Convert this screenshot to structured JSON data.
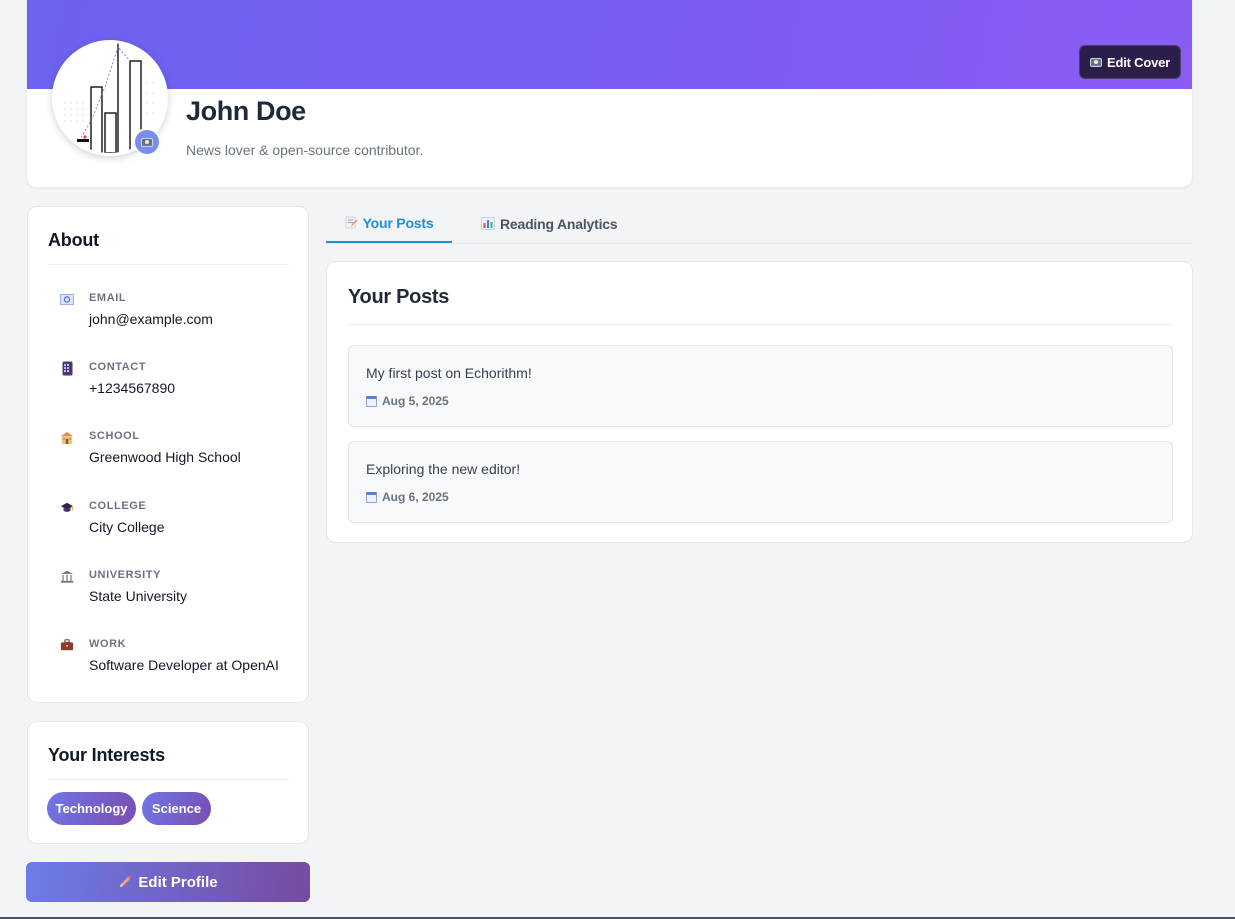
{
  "profile": {
    "name": "John Doe",
    "bio": "News lover & open-source contributor.",
    "edit_cover_label": "Edit Cover",
    "accent_gradient": [
      "#6c63f0",
      "#8b5cf6"
    ]
  },
  "about": {
    "title": "About",
    "items": [
      {
        "icon": "email-icon",
        "label": "EMAIL",
        "value": "john@example.com"
      },
      {
        "icon": "phone-icon",
        "label": "CONTACT",
        "value": "+1234567890"
      },
      {
        "icon": "school-icon",
        "label": "SCHOOL",
        "value": "Greenwood High School"
      },
      {
        "icon": "graduation-cap-icon",
        "label": "COLLEGE",
        "value": "City College"
      },
      {
        "icon": "university-icon",
        "label": "UNIVERSITY",
        "value": "State University"
      },
      {
        "icon": "briefcase-icon",
        "label": "WORK",
        "value": "Software Developer at OpenAI"
      }
    ]
  },
  "interests": {
    "title": "Your Interests",
    "tags": [
      "Technology",
      "Science"
    ]
  },
  "edit_profile_label": "Edit Profile",
  "tabs": [
    {
      "label": "Your Posts",
      "icon": "memo-icon",
      "active": true
    },
    {
      "label": "Reading Analytics",
      "icon": "bar-chart-icon",
      "active": false
    }
  ],
  "posts": {
    "title": "Your Posts",
    "items": [
      {
        "text": "My first post on Echorithm!",
        "date": "Aug 5, 2025"
      },
      {
        "text": "Exploring the new editor!",
        "date": "Aug 6, 2025"
      }
    ]
  },
  "colors": {
    "active_tab": "#1e90d6",
    "tag_gradient": [
      "#6f77e6",
      "#7a4db0"
    ]
  }
}
